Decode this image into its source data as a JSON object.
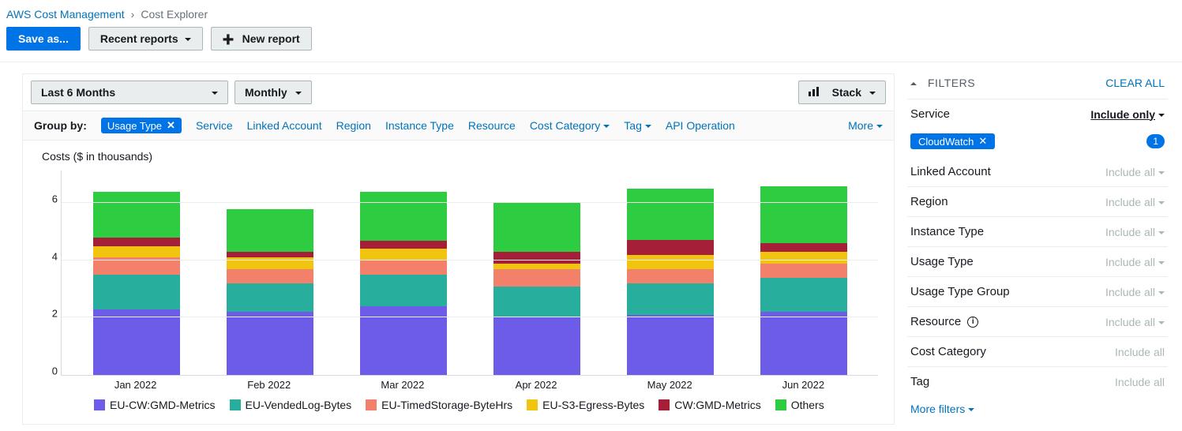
{
  "breadcrumb": {
    "root": "AWS Cost Management",
    "current": "Cost Explorer"
  },
  "toolbar": {
    "save": "Save as...",
    "recent": "Recent reports",
    "new": "New report"
  },
  "controls": {
    "range": "Last 6 Months",
    "granularity": "Monthly",
    "chartmode": "Stack"
  },
  "groupby": {
    "label": "Group by:",
    "active": "Usage Type",
    "options": [
      "Service",
      "Linked Account",
      "Region",
      "Instance Type",
      "Resource",
      "Cost Category",
      "Tag",
      "API Operation"
    ],
    "more": "More"
  },
  "chart_title": "Costs ($ in thousands)",
  "chart_data": {
    "type": "bar",
    "stacked": true,
    "ylabel": "Cost ($ thousands)",
    "ylim": [
      0,
      7
    ],
    "yticks": [
      0,
      2,
      4,
      6
    ],
    "categories": [
      "Jan 2022",
      "Feb 2022",
      "Mar 2022",
      "Apr 2022",
      "May 2022",
      "Jun 2022"
    ],
    "series": [
      {
        "name": "EU-CW:GMD-Metrics",
        "color": "#6c5ce7",
        "values": [
          2.3,
          2.2,
          2.4,
          2.0,
          2.1,
          2.2
        ]
      },
      {
        "name": "EU-VendedLog-Bytes",
        "color": "#27ae9c",
        "values": [
          1.2,
          1.0,
          1.1,
          1.1,
          1.1,
          1.2
        ]
      },
      {
        "name": "EU-TimedStorage-ByteHrs",
        "color": "#f3806a",
        "values": [
          0.6,
          0.5,
          0.5,
          0.6,
          0.5,
          0.5
        ]
      },
      {
        "name": "EU-S3-Egress-Bytes",
        "color": "#f1c40f",
        "values": [
          0.4,
          0.4,
          0.4,
          0.2,
          0.5,
          0.4
        ]
      },
      {
        "name": "CW:GMD-Metrics",
        "color": "#a61f38",
        "values": [
          0.3,
          0.2,
          0.3,
          0.4,
          0.5,
          0.3
        ]
      },
      {
        "name": "Others",
        "color": "#2ecc40",
        "values": [
          1.6,
          1.5,
          1.7,
          1.7,
          1.8,
          2.0
        ]
      }
    ]
  },
  "filters": {
    "title": "FILTERS",
    "clear": "CLEAR ALL",
    "include_only": "Include only",
    "include_all": "Include all",
    "service_tag": "CloudWatch",
    "service_count": "1",
    "rows": [
      "Service",
      "Linked Account",
      "Region",
      "Instance Type",
      "Usage Type",
      "Usage Type Group",
      "Resource",
      "Cost Category",
      "Tag"
    ],
    "more": "More filters"
  }
}
